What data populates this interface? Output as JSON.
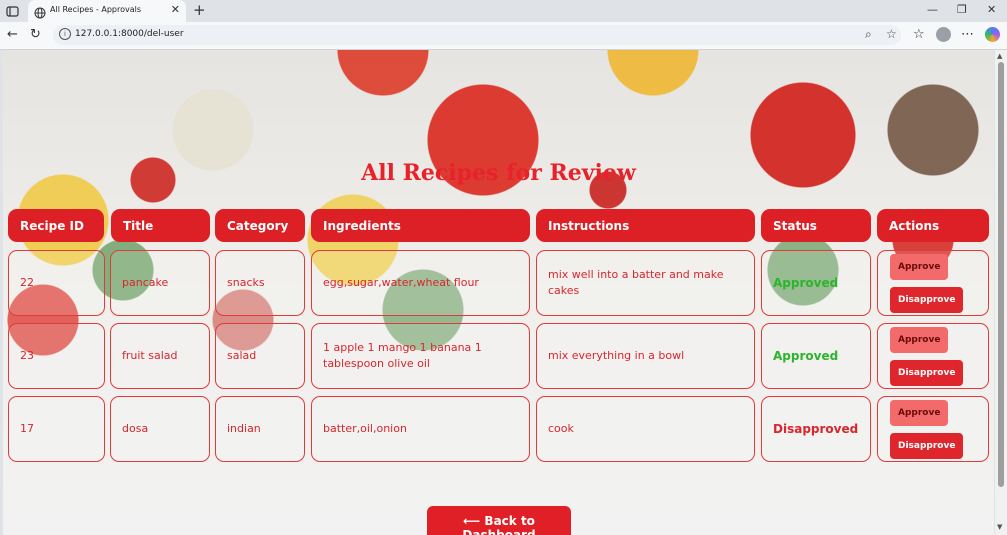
{
  "browser": {
    "tab_title": "All Recipes - Approvals",
    "url": "127.0.0.1:8000/del-user"
  },
  "page": {
    "title": "All Recipes for Review",
    "columns": [
      "Recipe ID",
      "Title",
      "Category",
      "Ingredients",
      "Instructions",
      "Status",
      "Actions"
    ],
    "rows": [
      {
        "id": "22",
        "title": "pancake",
        "category": "snacks",
        "ingredients": "egg,sugar,water,wheat flour",
        "instructions": "mix well into a batter and make cakes",
        "status": "Approved",
        "approve_label": "Approve",
        "disapprove_label": "Disapprove"
      },
      {
        "id": "23",
        "title": "fruit salad",
        "category": "salad",
        "ingredients": "1 apple 1 mango 1 banana 1 tablespoon olive oil",
        "instructions": "mix everything in a bowl",
        "status": "Approved",
        "approve_label": "Approve",
        "disapprove_label": "Disapprove"
      },
      {
        "id": "17",
        "title": "dosa",
        "category": "indian",
        "ingredients": "batter,oil,onion",
        "instructions": "cook",
        "status": "Disapproved",
        "approve_label": "Approve",
        "disapprove_label": "Disapprove"
      }
    ],
    "back_button": "⟵ Back to Dashboard"
  },
  "colors": {
    "primary": "#dc2026",
    "approved": "#2bb52b",
    "approve_button": "#f36a6a"
  }
}
